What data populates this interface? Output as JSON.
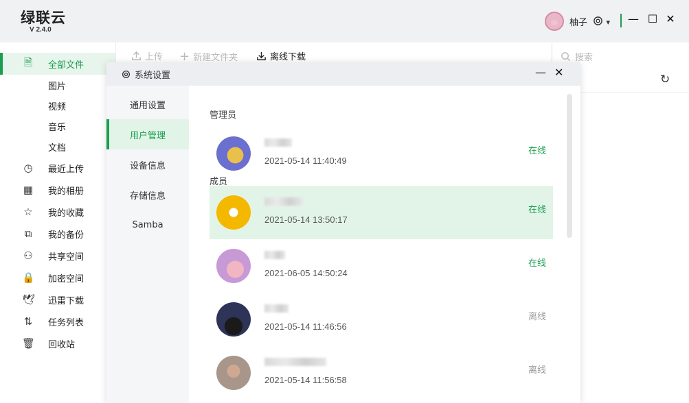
{
  "app": {
    "name": "绿联云",
    "version": "V 2.4.0"
  },
  "header": {
    "username": "柚子",
    "settings_icon": "gear-icon",
    "dropdown_glyph": "▾"
  },
  "window_controls": {
    "minimize": "—",
    "maximize": "☐",
    "close": "✕"
  },
  "sidebar": {
    "items": [
      {
        "label": "全部文件",
        "icon": "file-icon",
        "glyph": "🗎",
        "sub": false,
        "active": true
      },
      {
        "label": "图片",
        "sub": true
      },
      {
        "label": "视频",
        "sub": true
      },
      {
        "label": "音乐",
        "sub": true
      },
      {
        "label": "文档",
        "sub": true
      },
      {
        "label": "最近上传",
        "icon": "clock-icon",
        "glyph": "◷"
      },
      {
        "label": "我的相册",
        "icon": "grid-icon",
        "glyph": "▦"
      },
      {
        "label": "我的收藏",
        "icon": "star-icon",
        "glyph": "☆"
      },
      {
        "label": "我的备份",
        "icon": "backup-icon",
        "glyph": "⧉"
      },
      {
        "label": "共享空间",
        "icon": "users-icon",
        "glyph": "⚇"
      },
      {
        "label": "加密空间",
        "icon": "lock-icon",
        "glyph": "🔒"
      },
      {
        "label": "迅雷下载",
        "icon": "bird-icon",
        "glyph": "🕊"
      },
      {
        "label": "任务列表",
        "icon": "sort-arrows-icon",
        "glyph": "⇅"
      },
      {
        "label": "回收站",
        "icon": "trash-icon",
        "glyph": "🗑"
      }
    ]
  },
  "toolbar": {
    "upload": "上传",
    "new_folder": "新建文件夹",
    "offline_download": "离线下载",
    "search_placeholder": "搜索",
    "refresh_glyph": "↻"
  },
  "dialog": {
    "title": "系统设置",
    "nav": [
      "通用设置",
      "用户管理",
      "设备信息",
      "存储信息",
      "Samba"
    ],
    "active_nav": "用户管理",
    "sections": {
      "admin": "管理员",
      "members": "成员"
    },
    "admin": [
      {
        "time": "2021-05-14 11:40:49",
        "status": "在线",
        "online": true
      }
    ],
    "members": [
      {
        "time": "2021-05-14 13:50:17",
        "status": "在线",
        "online": true,
        "selected": true
      },
      {
        "time": "2021-06-05 14:50:24",
        "status": "在线",
        "online": true
      },
      {
        "time": "2021-05-14 11:46:56",
        "status": "离线",
        "online": false
      },
      {
        "time": "2021-05-14 11:56:58",
        "status": "离线",
        "online": false
      }
    ]
  },
  "colors": {
    "accent": "#1a9e4f",
    "selected_bg": "#e2f4e8",
    "offline": "#999999"
  }
}
